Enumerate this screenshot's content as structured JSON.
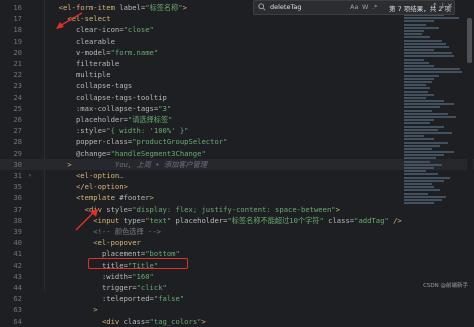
{
  "search": {
    "query": "deleteTag",
    "opt_case": "Aa",
    "opt_word": "W",
    "opt_regex": ".*",
    "result_count": "第 7 项结果，共 2 项",
    "nav_up": "↑",
    "nav_down": "↓",
    "close": "✕"
  },
  "lines": [
    {
      "num": "16",
      "tokens": [
        {
          "c": "t-txt",
          "v": "  "
        },
        {
          "c": "t-tag",
          "v": "<el-form-item "
        },
        {
          "c": "t-attr",
          "v": "label="
        },
        {
          "c": "t-str",
          "v": "\"标签名称\""
        },
        {
          "c": "t-tag",
          "v": ">"
        }
      ]
    },
    {
      "num": "17",
      "tokens": [
        {
          "c": "t-txt",
          "v": "    "
        },
        {
          "c": "t-tag",
          "v": "<el-select"
        }
      ]
    },
    {
      "num": "18",
      "tokens": [
        {
          "c": "t-txt",
          "v": "      "
        },
        {
          "c": "t-attr",
          "v": "clear-icon="
        },
        {
          "c": "t-str",
          "v": "\"close\""
        }
      ]
    },
    {
      "num": "19",
      "tokens": [
        {
          "c": "t-txt",
          "v": "      "
        },
        {
          "c": "t-attr",
          "v": "clearable"
        }
      ]
    },
    {
      "num": "20",
      "tokens": [
        {
          "c": "t-txt",
          "v": "      "
        },
        {
          "c": "t-attr",
          "v": "v-model="
        },
        {
          "c": "t-str",
          "v": "\"form.name\""
        }
      ]
    },
    {
      "num": "21",
      "tokens": [
        {
          "c": "t-txt",
          "v": "      "
        },
        {
          "c": "t-attr",
          "v": "filterable"
        }
      ]
    },
    {
      "num": "22",
      "tokens": [
        {
          "c": "t-txt",
          "v": "      "
        },
        {
          "c": "t-attr",
          "v": "multiple"
        }
      ]
    },
    {
      "num": "23",
      "tokens": [
        {
          "c": "t-txt",
          "v": "      "
        },
        {
          "c": "t-attr",
          "v": "collapse-tags"
        }
      ]
    },
    {
      "num": "24",
      "tokens": [
        {
          "c": "t-txt",
          "v": "      "
        },
        {
          "c": "t-attr",
          "v": "collapse-tags-tooltip"
        }
      ]
    },
    {
      "num": "25",
      "tokens": [
        {
          "c": "t-txt",
          "v": "      "
        },
        {
          "c": "t-attr",
          "v": ":max-collapse-tags="
        },
        {
          "c": "t-str",
          "v": "\"3\""
        }
      ]
    },
    {
      "num": "26",
      "tokens": [
        {
          "c": "t-txt",
          "v": "      "
        },
        {
          "c": "t-attr",
          "v": "placeholder="
        },
        {
          "c": "t-str",
          "v": "\"请选择标签\""
        }
      ]
    },
    {
      "num": "27",
      "tokens": [
        {
          "c": "t-txt",
          "v": "      "
        },
        {
          "c": "t-attr",
          "v": ":style="
        },
        {
          "c": "t-str",
          "v": "\"{ width: '100%' }\""
        }
      ]
    },
    {
      "num": "28",
      "tokens": [
        {
          "c": "t-txt",
          "v": "      "
        },
        {
          "c": "t-attr",
          "v": "popper-class="
        },
        {
          "c": "t-str",
          "v": "\"productGroupSelector\""
        }
      ]
    },
    {
      "num": "29",
      "tokens": [
        {
          "c": "t-txt",
          "v": "      "
        },
        {
          "c": "t-attr",
          "v": "@change="
        },
        {
          "c": "t-str",
          "v": "\"handleSegment3Change\""
        }
      ]
    },
    {
      "num": "30",
      "tokens": [
        {
          "c": "t-txt",
          "v": "    "
        },
        {
          "c": "t-tag",
          "v": ">"
        },
        {
          "c": "t-hint",
          "v": "          You, 上周 • 添加客户管理"
        }
      ]
    },
    {
      "num": "31",
      "tokens": [
        {
          "c": "t-txt",
          "v": "      "
        },
        {
          "c": "t-tag",
          "v": "<el-option"
        },
        {
          "c": "t-cmt",
          "v": "…"
        }
      ]
    },
    {
      "num": "35",
      "tokens": [
        {
          "c": "t-txt",
          "v": "      "
        },
        {
          "c": "t-tag",
          "v": "</el-option>"
        }
      ]
    },
    {
      "num": "36",
      "tokens": [
        {
          "c": "t-txt",
          "v": "      "
        },
        {
          "c": "t-tag",
          "v": "<template "
        },
        {
          "c": "t-attr",
          "v": "#footer"
        },
        {
          "c": "t-tag",
          "v": ">"
        }
      ]
    },
    {
      "num": "37",
      "tokens": [
        {
          "c": "t-txt",
          "v": "        "
        },
        {
          "c": "t-tag",
          "v": "<div "
        },
        {
          "c": "t-attr",
          "v": "style="
        },
        {
          "c": "t-str",
          "v": "\"display: flex; justify-content: space-between\""
        },
        {
          "c": "t-tag",
          "v": ">"
        }
      ]
    },
    {
      "num": "38",
      "tokens": [
        {
          "c": "t-txt",
          "v": "          "
        },
        {
          "c": "t-tag",
          "v": "<input "
        },
        {
          "c": "t-attr",
          "v": "type="
        },
        {
          "c": "t-str",
          "v": "\"text\""
        },
        {
          "c": "t-attr",
          "v": " placeholder="
        },
        {
          "c": "t-str",
          "v": "\"标签名称不能超过10个字符\""
        },
        {
          "c": "t-attr",
          "v": " class="
        },
        {
          "c": "t-str",
          "v": "\"addTag\""
        },
        {
          "c": "t-tag",
          "v": " />"
        }
      ]
    },
    {
      "num": "39",
      "tokens": [
        {
          "c": "t-txt",
          "v": "          "
        },
        {
          "c": "t-cmt",
          "v": "<!-- 颜色选择 -->"
        }
      ]
    },
    {
      "num": "40",
      "tokens": [
        {
          "c": "t-txt",
          "v": "          "
        },
        {
          "c": "t-tag",
          "v": "<el-popover"
        }
      ]
    },
    {
      "num": "41",
      "tokens": [
        {
          "c": "t-txt",
          "v": "            "
        },
        {
          "c": "t-attr",
          "v": "placement="
        },
        {
          "c": "t-str",
          "v": "\"bottom\""
        }
      ]
    },
    {
      "num": "42",
      "tokens": [
        {
          "c": "t-txt",
          "v": "            "
        },
        {
          "c": "t-attr",
          "v": "title="
        },
        {
          "c": "t-str",
          "v": "\"Title\""
        }
      ]
    },
    {
      "num": "43",
      "tokens": [
        {
          "c": "t-txt",
          "v": "            "
        },
        {
          "c": "t-attr",
          "v": ":width="
        },
        {
          "c": "t-str",
          "v": "\"160\""
        }
      ]
    },
    {
      "num": "44",
      "tokens": [
        {
          "c": "t-txt",
          "v": "            "
        },
        {
          "c": "t-attr",
          "v": "trigger="
        },
        {
          "c": "t-str",
          "v": "\"click\""
        }
      ]
    },
    {
      "num": "62",
      "tokens": [
        {
          "c": "t-txt",
          "v": "            "
        },
        {
          "c": "t-attr",
          "v": ":teleported="
        },
        {
          "c": "t-str",
          "v": "\"false\""
        }
      ]
    },
    {
      "num": "63",
      "tokens": [
        {
          "c": "t-txt",
          "v": "          "
        },
        {
          "c": "t-tag",
          "v": ">"
        }
      ]
    },
    {
      "num": "64",
      "tokens": [
        {
          "c": "t-txt",
          "v": "            "
        },
        {
          "c": "t-tag",
          "v": "<div "
        },
        {
          "c": "t-attr",
          "v": "class="
        },
        {
          "c": "t-str",
          "v": "\"tag_colors\""
        },
        {
          "c": "t-tag",
          "v": ">"
        }
      ]
    }
  ],
  "fold_lines": [
    "31"
  ],
  "watermark": "CSDN @前端新手",
  "colors": {
    "accent_red": "#e0302a",
    "background": "#1e1f22"
  }
}
